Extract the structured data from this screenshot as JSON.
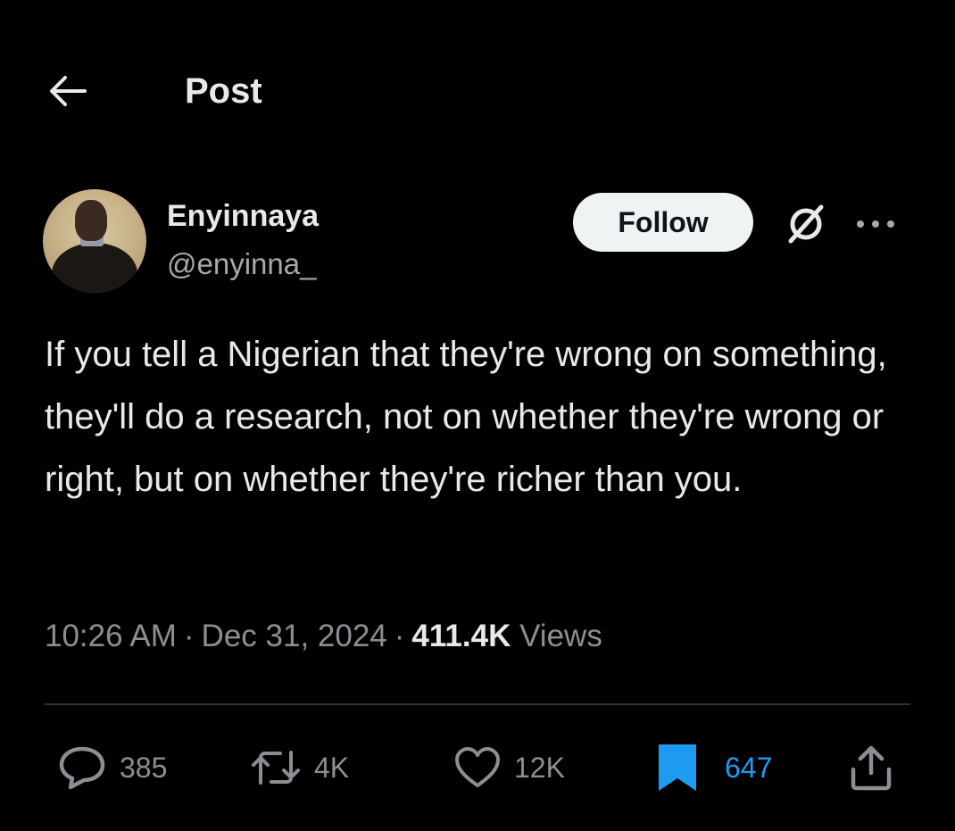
{
  "header": {
    "title": "Post"
  },
  "author": {
    "display_name": "Enyinnaya",
    "handle": "@enyinna_",
    "follow_label": "Follow"
  },
  "tweet": {
    "text": "If you tell a Nigerian that they're wrong on something, they'll do a research, not on whether they're wrong or right, but on whether they're richer than you."
  },
  "meta": {
    "time": "10:26 AM",
    "date": "Dec 31, 2024",
    "separator": "·",
    "views_count": "411.4K",
    "views_label": "Views"
  },
  "actions": {
    "replies": "385",
    "reposts": "4K",
    "likes": "12K",
    "bookmarks": "647"
  },
  "colors": {
    "background": "#000000",
    "text_primary": "#e7e9ea",
    "text_secondary": "#8b8f94",
    "accent": "#1d9bf0",
    "divider": "#2f3336"
  },
  "icons": [
    "back-arrow-icon",
    "grok-icon",
    "more-icon",
    "reply-icon",
    "repost-icon",
    "like-icon",
    "bookmark-icon",
    "share-icon"
  ]
}
